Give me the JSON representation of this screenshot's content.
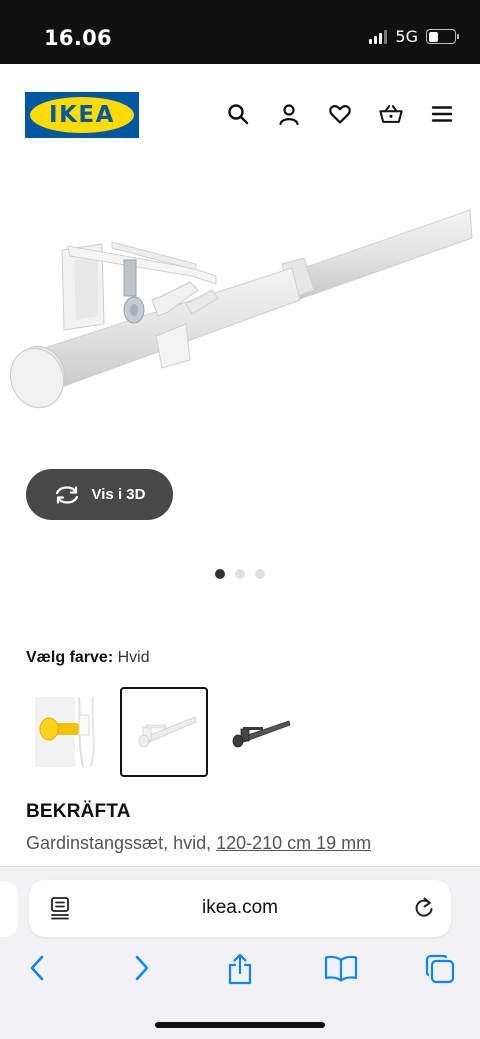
{
  "status_bar": {
    "time": "16.06",
    "network": "5G"
  },
  "header": {
    "logo_text": "IKEA",
    "icons": [
      "search-icon",
      "user-icon",
      "heart-icon",
      "basket-icon",
      "menu-icon"
    ]
  },
  "product": {
    "view_3d_label": "Vis i 3D",
    "carousel_dot_count": 3,
    "carousel_active_index": 0,
    "color_label": "Vælg farve:",
    "color_value": "Hvid",
    "swatches": [
      "gul",
      "hvid",
      "sort"
    ],
    "swatch_selected_index": 1,
    "name": "BEKRÄFTA",
    "description_prefix": "Gardinstangssæt, hvid,",
    "description_size": "120-210 cm 19 mm"
  },
  "browser": {
    "url": "ikea.com",
    "toolbar_icons": [
      "back-icon",
      "forward-icon",
      "share-icon",
      "bookmarks-icon",
      "tabs-icon"
    ]
  },
  "colors": {
    "status_bar_bg": "#111111",
    "ikea_blue": "#0058a3",
    "ikea_yellow": "#ffdb00",
    "button_3d_bg": "#484848",
    "browser_accent": "#0a84ff"
  }
}
